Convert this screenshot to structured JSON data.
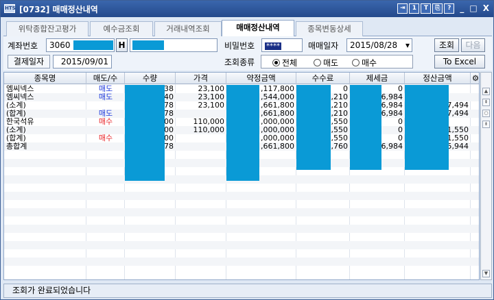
{
  "window": {
    "app_icon": "HTS",
    "title": "[0732] 매매정산내역"
  },
  "title_buttons": [
    "⇥",
    "1",
    "T",
    "⎘",
    "?"
  ],
  "window_controls": [
    "_",
    "□",
    "X"
  ],
  "tabs": [
    {
      "label": "위탁종합잔고평가",
      "active": false
    },
    {
      "label": "예수금조회",
      "active": false
    },
    {
      "label": "거래내역조회",
      "active": false
    },
    {
      "label": "매매정산내역",
      "active": true
    },
    {
      "label": "종목변동상세",
      "active": false
    }
  ],
  "form": {
    "account_label": "계좌번호",
    "account_value": "3060",
    "account_h_button": "H",
    "password_label": "비밀번호",
    "password_value": "****",
    "trade_date_label": "매매일자",
    "trade_date_value": "2015/08/28",
    "settle_date_label": "결제일자",
    "settle_date_value": "2015/09/01",
    "search_type_label": "조회종류",
    "radios": [
      {
        "label": "전체",
        "selected": true
      },
      {
        "label": "매도",
        "selected": false
      },
      {
        "label": "매수",
        "selected": false
      }
    ],
    "search_button": "조회",
    "next_button": "다음",
    "excel_button": "To Excel"
  },
  "table": {
    "columns": [
      "종목명",
      "매도/수",
      "수량",
      "가격",
      "약정금액",
      "수수료",
      "제세금",
      "정산금액"
    ],
    "rows": [
      [
        "엠씨넥스",
        "매도",
        "38",
        "23,100",
        ",117,800",
        "0",
        "0",
        ""
      ],
      [
        "엠씨넥스",
        "매도",
        "40",
        "23,100",
        ",544,000",
        ",210",
        "6,984",
        ""
      ],
      [
        "(소계)",
        "",
        "78",
        "23,100",
        ",661,800",
        ",210",
        "6,984",
        "7,494"
      ],
      [
        "(합계)",
        "매도",
        "78",
        "",
        ",661,800",
        ",210",
        "6,984",
        "7,494"
      ],
      [
        "한국석유",
        "매수",
        "00",
        "110,000",
        ",000,000",
        ",550",
        "0",
        ""
      ],
      [
        "(소계)",
        "",
        "00",
        "110,000",
        ",000,000",
        ",550",
        "0",
        "1,550"
      ],
      [
        "(합계)",
        "매수",
        "00",
        "",
        ",000,000",
        ",550",
        "0",
        "1,550"
      ],
      [
        "총합계",
        "",
        "78",
        "",
        ",661,800",
        ",760",
        "6,984",
        "5,944"
      ]
    ]
  },
  "status": {
    "message": "조회가 완료되었습니다"
  },
  "colors": {
    "mask": "#0a9ad6",
    "sell": "#1f3adb",
    "buy": "#e8262a",
    "title_bar": "#2f569b"
  }
}
